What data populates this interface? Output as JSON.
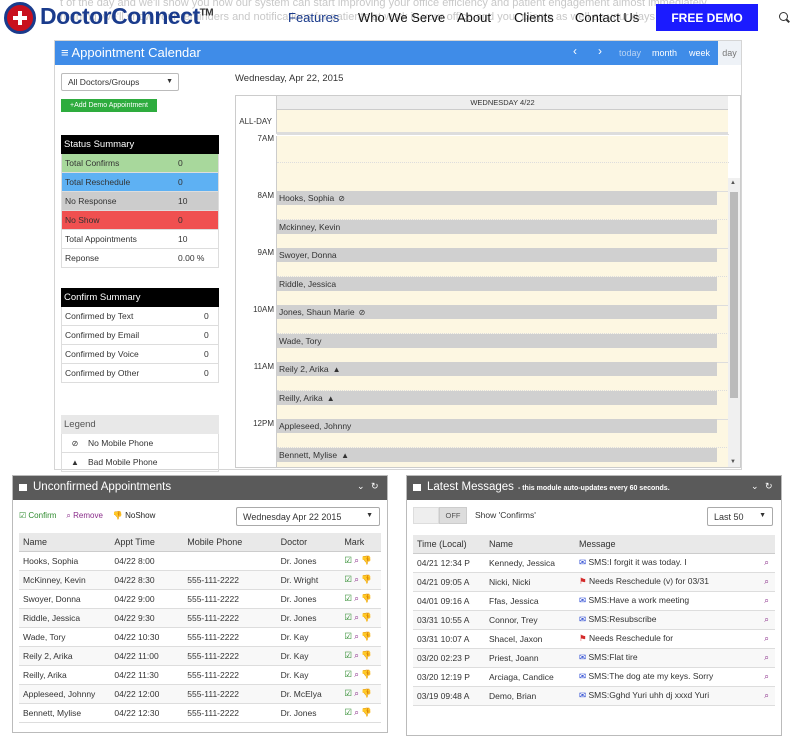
{
  "nav": {
    "brand": "DoctorConnect",
    "tm": "TM",
    "menu": [
      "Features",
      "Who We Serve",
      "About",
      "Clients",
      "Contact Us"
    ],
    "demo_button": "FREE DEMO",
    "background_lines": [
      "t of the day and we'll show you how our system can start improving your office efficiency and patient engagement almost immediately",
      "running, we'll show your reminders and notifications for patients at work in your office and your clients as well as your days"
    ]
  },
  "calendar": {
    "title": "Appointment Calendar",
    "nav": {
      "prev": "‹",
      "next": "›",
      "today": "today",
      "month": "month",
      "week": "week",
      "day": "day"
    },
    "doctor_select": "All Doctors/Groups",
    "add_demo": "+Add Demo Appointment",
    "date_heading": "Wednesday, Apr 22, 2015",
    "day_header": "WEDNESDAY 4/22",
    "all_day": "ALL-DAY",
    "hours": [
      "7AM",
      "8AM",
      "9AM",
      "10AM",
      "11AM",
      "12PM"
    ],
    "events": [
      {
        "name": "Hooks, Sophia",
        "mark": "⊘"
      },
      {
        "name": "Mckinney, Kevin",
        "mark": ""
      },
      {
        "name": "Swoyer, Donna",
        "mark": ""
      },
      {
        "name": "Riddle, Jessica",
        "mark": ""
      },
      {
        "name": "Jones, Shaun Marie",
        "mark": "⊘"
      },
      {
        "name": "Wade, Tory",
        "mark": ""
      },
      {
        "name": "Reily 2, Arika",
        "mark": "▲"
      },
      {
        "name": "Reilly, Arika",
        "mark": "▲"
      },
      {
        "name": "Appleseed, Johnny",
        "mark": ""
      },
      {
        "name": "Bennett, Mylise",
        "mark": "▲"
      }
    ]
  },
  "status_summary": {
    "title": "Status Summary",
    "rows": [
      {
        "label": "Total Confirms",
        "value": "0",
        "color": "#a8d89c"
      },
      {
        "label": "Total Reschedule",
        "value": "0",
        "color": "#5eb1f3"
      },
      {
        "label": "No Response",
        "value": "10",
        "color": "#cccccc"
      },
      {
        "label": "No Show",
        "value": "0",
        "color": "#f05050"
      },
      {
        "label": "Total Appointments",
        "value": "10",
        "color": "#ffffff"
      },
      {
        "label": "Reponse",
        "value": "0.00 %",
        "color": "#ffffff"
      }
    ]
  },
  "confirm_summary": {
    "title": "Confirm Summary",
    "rows": [
      {
        "label": "Confirmed by Text",
        "value": "0"
      },
      {
        "label": "Confirmed by Email",
        "value": "0"
      },
      {
        "label": "Confirmed by Voice",
        "value": "0"
      },
      {
        "label": "Confirmed by Other",
        "value": "0"
      }
    ]
  },
  "legend": {
    "title": "Legend",
    "rows": [
      {
        "icon": "⊘",
        "label": "No Mobile Phone"
      },
      {
        "icon": "▲",
        "label": "Bad Mobile Phone"
      }
    ]
  },
  "unconfirmed": {
    "title": "Unconfirmed Appointments",
    "actions": {
      "confirm": "Confirm",
      "remove": "Remove",
      "noshow": "NoShow"
    },
    "date_select": "Wednesday Apr 22 2015",
    "columns": [
      "Name",
      "Appt Time",
      "Mobile Phone",
      "Doctor",
      "Mark"
    ],
    "rows": [
      [
        "Hooks, Sophia",
        "04/22 8:00",
        "",
        "Dr. Jones"
      ],
      [
        "McKinney, Kevin",
        "04/22 8:30",
        "555-111-2222",
        "Dr. Wright"
      ],
      [
        "Swoyer, Donna",
        "04/22 9:00",
        "555-111-2222",
        "Dr. Jones"
      ],
      [
        "Riddle, Jessica",
        "04/22 9:30",
        "555-111-2222",
        "Dr. Jones"
      ],
      [
        "Wade, Tory",
        "04/22 10:30",
        "555-111-2222",
        "Dr. Kay"
      ],
      [
        "Reily 2, Arika",
        "04/22 11:00",
        "555-111-2222",
        "Dr. Kay"
      ],
      [
        "Reilly, Arika",
        "04/22 11:30",
        "555-111-2222",
        "Dr. Kay"
      ],
      [
        "Appleseed, Johnny",
        "04/22 12:00",
        "555-111-2222",
        "Dr. McElya"
      ],
      [
        "Bennett, Mylise",
        "04/22 12:30",
        "555-111-2222",
        "Dr. Jones"
      ]
    ]
  },
  "messages": {
    "title": "Latest Messages",
    "subtitle": "- this module auto-updates every 60 seconds.",
    "toggle": "OFF",
    "show_label": "Show 'Confirms'",
    "limit_select": "Last 50",
    "columns": [
      "Time (Local)",
      "Name",
      "Message"
    ],
    "rows": [
      {
        "time": "04/21 12:34 P",
        "name": "Kennedy, Jessica",
        "type": "env",
        "msg": "SMS:I forgit it was today. I"
      },
      {
        "time": "04/21 09:05 A",
        "name": "Nicki, Nicki",
        "type": "flag",
        "msg": "Needs Reschedule (v) for 03/31"
      },
      {
        "time": "04/01 09:16 A",
        "name": "Ffas, Jessica",
        "type": "env",
        "msg": "SMS:Have a work meeting"
      },
      {
        "time": "03/31 10:55 A",
        "name": "Connor, Trey",
        "type": "env",
        "msg": "SMS:Resubscribe"
      },
      {
        "time": "03/31 10:07 A",
        "name": "Shacel, Jaxon",
        "type": "flag",
        "msg": "Needs Reschedule for"
      },
      {
        "time": "03/20 02:23 P",
        "name": "Priest, Joann",
        "type": "env",
        "msg": "SMS:Flat tire"
      },
      {
        "time": "03/20 12:19 P",
        "name": "Arciaga, Candice",
        "type": "env",
        "msg": "SMS:The dog ate my keys. Sorry"
      },
      {
        "time": "03/19 09:48 A",
        "name": "Demo, Brian",
        "type": "env",
        "msg": "SMS:Gghd Yuri uhh dj xxxd Yuri"
      }
    ]
  }
}
